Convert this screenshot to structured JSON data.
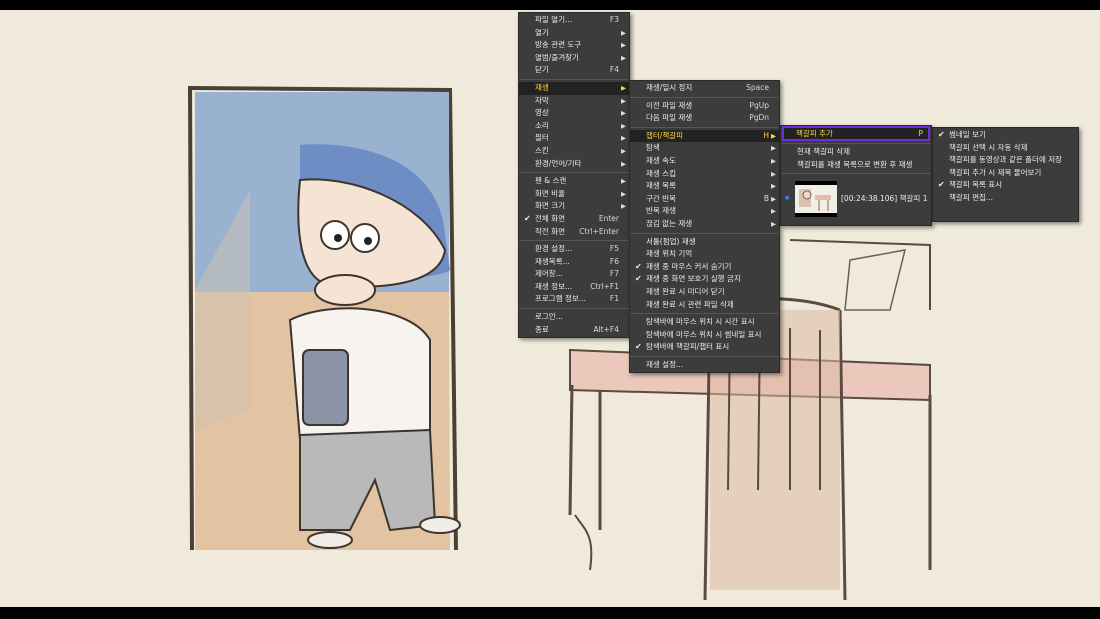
{
  "menu_main": [
    {
      "label": "파일 열기...",
      "shortcut": "F3"
    },
    {
      "label": "열기",
      "submenu": true
    },
    {
      "label": "방송 관련 도구",
      "submenu": true
    },
    {
      "label": "열범/즐겨찾기",
      "submenu": true
    },
    {
      "label": "닫기",
      "shortcut": "F4"
    },
    {
      "label": "재생",
      "submenu": true,
      "selected": true
    },
    {
      "label": "자막",
      "submenu": true
    },
    {
      "label": "영상",
      "submenu": true
    },
    {
      "label": "소리",
      "submenu": true
    },
    {
      "label": "필터",
      "submenu": true
    },
    {
      "label": "스킨",
      "submenu": true
    },
    {
      "label": "환경/언어/기타",
      "submenu": true
    },
    {
      "label": "팬 & 스캔",
      "submenu": true
    },
    {
      "label": "화면 비율",
      "submenu": true
    },
    {
      "label": "화면 크기",
      "submenu": true
    },
    {
      "label": "전체 화면",
      "shortcut": "Enter",
      "checked": true
    },
    {
      "label": "작전 화면",
      "shortcut": "Ctrl+Enter"
    },
    {
      "label": "환경 설정...",
      "shortcut": "F5"
    },
    {
      "label": "재생목록...",
      "shortcut": "F6"
    },
    {
      "label": "제어창...",
      "shortcut": "F7"
    },
    {
      "label": "재생 정보...",
      "shortcut": "Ctrl+F1"
    },
    {
      "label": "프로그램 정보...",
      "shortcut": "F1"
    },
    {
      "label": "로그인..."
    },
    {
      "label": "종료",
      "shortcut": "Alt+F4"
    }
  ],
  "menu_play": [
    {
      "label": "재생/일시 정지",
      "shortcut": "Space"
    },
    {
      "label": "이전 파일 재생",
      "shortcut": "PgUp"
    },
    {
      "label": "다음 파일 재생",
      "shortcut": "PgDn"
    },
    {
      "label": "챕터/책갈피",
      "shortcut": "H",
      "submenu": true,
      "selected": true
    },
    {
      "label": "탐색",
      "submenu": true
    },
    {
      "label": "재생 속도",
      "submenu": true
    },
    {
      "label": "재생 스킵",
      "submenu": true
    },
    {
      "label": "재생 목록",
      "submenu": true
    },
    {
      "label": "구간 반복",
      "shortcut": "B",
      "submenu": true
    },
    {
      "label": "반복 재생",
      "submenu": true
    },
    {
      "label": "끊김 없는 재생",
      "submenu": true
    },
    {
      "label": "서툴(펌업) 재생"
    },
    {
      "label": "재생 위치 기억"
    },
    {
      "label": "재생 중 마우스 커서 숨기기",
      "checked": true
    },
    {
      "label": "재생 중 화면 보호기 실행 금지",
      "checked": true
    },
    {
      "label": "재생 완료 시 미디어 닫기"
    },
    {
      "label": "재생 완료 시 관련 파일 삭제"
    },
    {
      "label": "탐색바에 마우스 위치 시 시간 표시"
    },
    {
      "label": "탐색바에 마우스 위치 시 썸네일 표시"
    },
    {
      "label": "탐색바에 책갈피/챕터 표시",
      "checked": true
    },
    {
      "label": "재생 설정..."
    }
  ],
  "menu_chapter": {
    "add": {
      "label": "책갈피 추가",
      "shortcut": "P"
    },
    "delete_current": "현재 책갈피 삭제",
    "convert": "책갈피를 재생 목록으로 변환 후 재생",
    "bookmark_1": "[00:24:38.106] 책갈피 1"
  },
  "menu_bookmark_opts": [
    {
      "label": "썸네일 보기",
      "checked": true
    },
    {
      "label": "책갈피 선택 시 자동 삭제"
    },
    {
      "label": "책갈피를 동영상과 같은 폴더에 저장"
    },
    {
      "label": "책갈피 추가 시 제목 물어보기"
    },
    {
      "label": "책갈피 목록 표시",
      "checked": true
    },
    {
      "label": "책갈피 편집..."
    }
  ],
  "colors": {
    "menu_bg": "#3c3c3c",
    "highlight_text": "#ffd83a",
    "highlight_border": "#6a2fd8",
    "check_dot": "#3e7ee8"
  },
  "icons": {
    "check": "check-icon",
    "submenu": "triangle-right-icon",
    "bullet": "bullet-icon"
  }
}
